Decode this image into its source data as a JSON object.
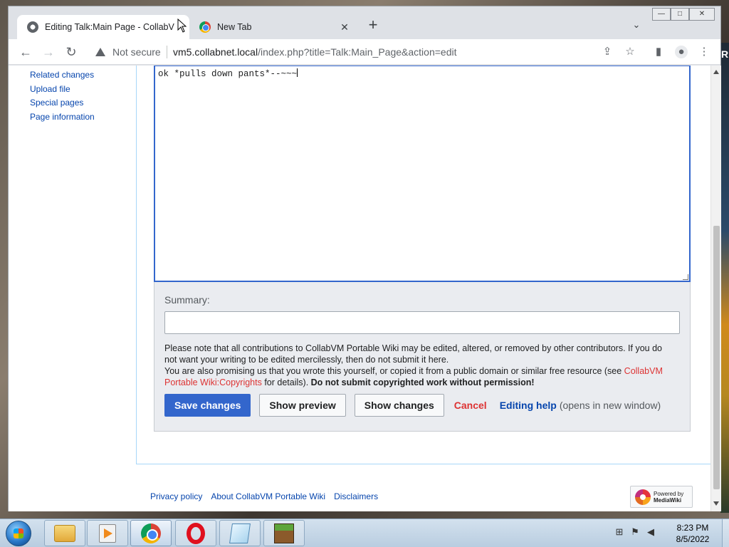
{
  "browser": {
    "tabs": [
      {
        "title": "Editing Talk:Main Page - CollabV",
        "active": true,
        "favicon": "globe-icon"
      },
      {
        "title": "New Tab",
        "active": false,
        "favicon": "chrome-icon"
      }
    ],
    "new_tab_label": "+",
    "security_label": "Not secure",
    "url_host": "vm5.collabnet.local",
    "url_path": "/index.php?title=Talk:Main_Page&action=edit",
    "window_controls": {
      "minimize": "—",
      "maximize": "□",
      "close": "✕"
    }
  },
  "wiki": {
    "sidebar_tools": [
      "Related changes",
      "Upload file",
      "Special pages",
      "Page information"
    ],
    "editor_text": "ok *pulls down pants*--~~~",
    "summary_label": "Summary:",
    "summary_value": "",
    "notice": {
      "line1": "Please note that all contributions to CollabVM Portable Wiki may be edited, altered, or removed by other contributors. If you do not want your writing to be edited mercilessly, then do not submit it here.",
      "line2_pre": "You are also promising us that you wrote this yourself, or copied it from a public domain or similar free resource (see ",
      "line2_link": "CollabVM Portable Wiki:Copyrights",
      "line2_post": " for details). ",
      "line2_bold": "Do not submit copyrighted work without permission!"
    },
    "buttons": {
      "save": "Save changes",
      "preview": "Show preview",
      "changes": "Show changes",
      "cancel": "Cancel",
      "help": "Editing help",
      "help_note": "(opens in new window)"
    },
    "footer_links": [
      "Privacy policy",
      "About CollabVM Portable Wiki",
      "Disclaimers"
    ],
    "powered_by": {
      "line1": "Powered by",
      "line2": "MediaWiki"
    }
  },
  "taskbar": {
    "apps": [
      "windows-explorer",
      "windows-media-player",
      "google-chrome",
      "opera",
      "notepad",
      "minecraft"
    ],
    "active_app": "google-chrome",
    "time": "8:23 PM",
    "date": "8/5/2022"
  },
  "desktop": {
    "wallpaper_letter": "R"
  }
}
